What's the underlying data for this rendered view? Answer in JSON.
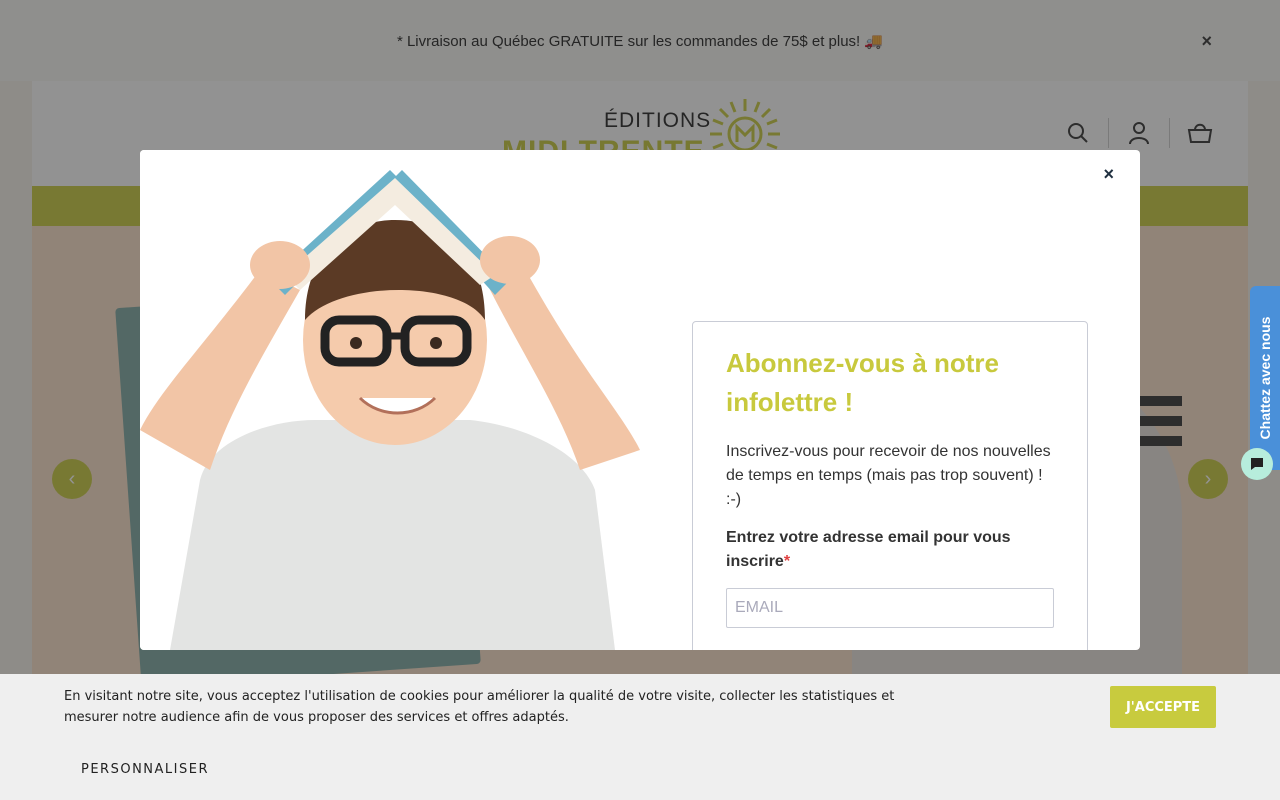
{
  "announcement": {
    "text": "* Livraison au Québec GRATUITE sur les commandes de 75$ et plus! 🚚",
    "close": "×"
  },
  "header": {
    "logo_line1": "ÉDITIONS",
    "logo_line2": "MIDI TRENTE",
    "icons": [
      "search-icon",
      "account-icon",
      "cart-icon"
    ]
  },
  "hero": {
    "prev": "‹",
    "next": "›"
  },
  "modal": {
    "close": "×",
    "title": "Abonnez-vous à notre infolettre !",
    "text": "Inscrivez-vous pour recevoir de nos nouvelles de temps en temps (mais pas trop souvent) ! :-)",
    "label": "Entrez votre adresse email pour vous inscrire",
    "required_mark": "*",
    "email_placeholder": "EMAIL"
  },
  "cookie": {
    "text": "En visitant notre site, vous acceptez l'utilisation de cookies pour améliorer la qualité de votre visite, collecter les statistiques et mesurer notre audience afin de vous proposer des services et offres adaptés.",
    "accept": "J'ACCEPTE",
    "customize": "PERSONNALISER"
  },
  "chat": {
    "label": "Chattez avec nous"
  },
  "colors": {
    "brand": "#c8cb3e",
    "chat": "#4a90d9"
  }
}
